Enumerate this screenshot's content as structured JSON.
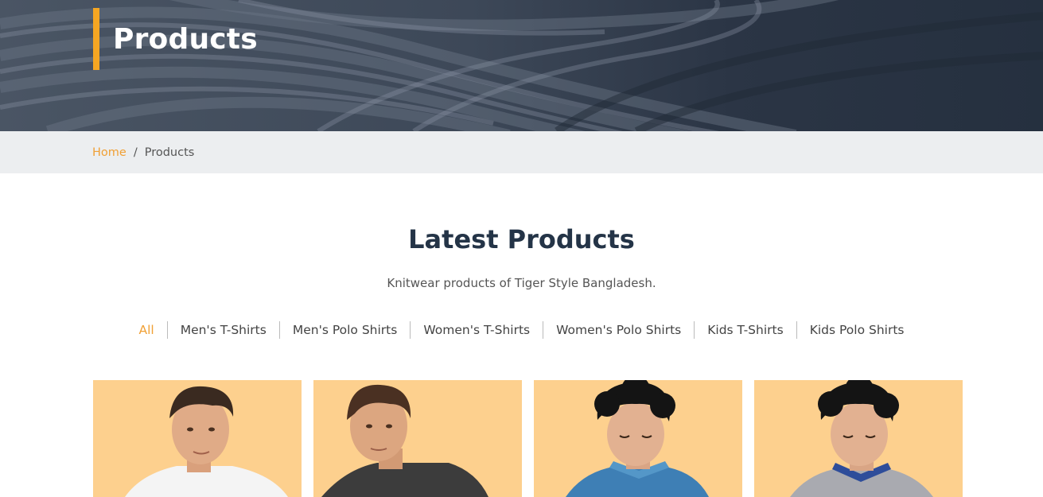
{
  "hero": {
    "title": "Products"
  },
  "breadcrumb": {
    "home": "Home",
    "separator": "/",
    "current": "Products"
  },
  "section": {
    "title": "Latest Products",
    "subtitle": "Knitwear products of Tiger Style Bangladesh."
  },
  "filters": [
    "All",
    "Men's T-Shirts",
    "Men's Polo Shirts",
    "Women's T-Shirts",
    "Women's Polo Shirts",
    "Kids T-Shirts",
    "Kids Polo Shirts"
  ],
  "active_filter": "All",
  "colors": {
    "accent": "#f5a623",
    "link": "#f0a035",
    "heading": "#243447",
    "card_bg": "#fdd08e",
    "hero_bg": "#2b3545"
  },
  "products": [
    {
      "image": "model-white-tshirt"
    },
    {
      "image": "model-charcoal-tshirt"
    },
    {
      "image": "model-blue-polo"
    },
    {
      "image": "model-grey-polo"
    }
  ]
}
